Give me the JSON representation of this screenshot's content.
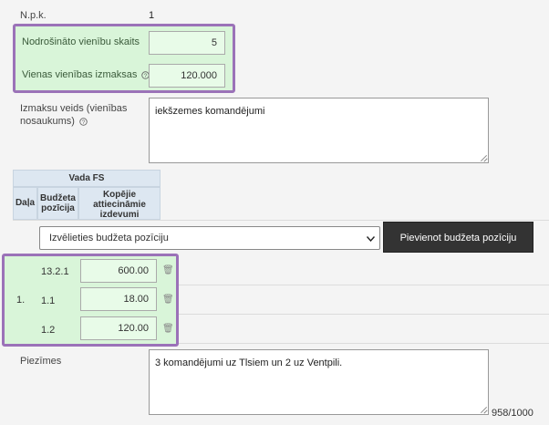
{
  "form": {
    "npk_label": "N.p.k.",
    "npk_value": "1",
    "units_label": "Nodrošināto vienību skaits",
    "units_value": "5",
    "unit_cost_label": "Vienas vienības izmaksas",
    "unit_cost_value": "120.000",
    "payment_type_label_line1": "Izmaksu veids (vienības",
    "payment_type_label_line2": "nosaukums)",
    "payment_type_value": "iekšzemes komandējumi",
    "notes_label": "Piezīmes",
    "notes_value": "3 komandējumi uz Tlsiem un 2 uz Ventpili.",
    "notes_counter": "958/1000"
  },
  "budget": {
    "group_header": "Vada FS",
    "col_part": "Daļa",
    "col_position_line1": "Budžeta",
    "col_position_line2": "pozīcija",
    "col_total_line1": "Kopējie",
    "col_total_line2": "attiecināmie",
    "col_total_line3": "izdevumi",
    "select_placeholder": "Izvēlieties budžeta pozīciju",
    "add_button": "Pievienot budžeta pozīciju",
    "part_number": "1.",
    "rows": [
      {
        "position": "13.2.1",
        "amount": "600.00"
      },
      {
        "position": "1.1",
        "amount": "18.00"
      },
      {
        "position": "1.2",
        "amount": "120.00"
      }
    ]
  },
  "icons": {
    "info": "info-circle-icon",
    "trash": "trash-icon",
    "dropdown": "chevron-down-icon"
  },
  "colors": {
    "highlight": "#9b72b8",
    "green_fill": "#d9f5d9",
    "table_header": "#dde7f1",
    "dark_button": "#333333"
  }
}
